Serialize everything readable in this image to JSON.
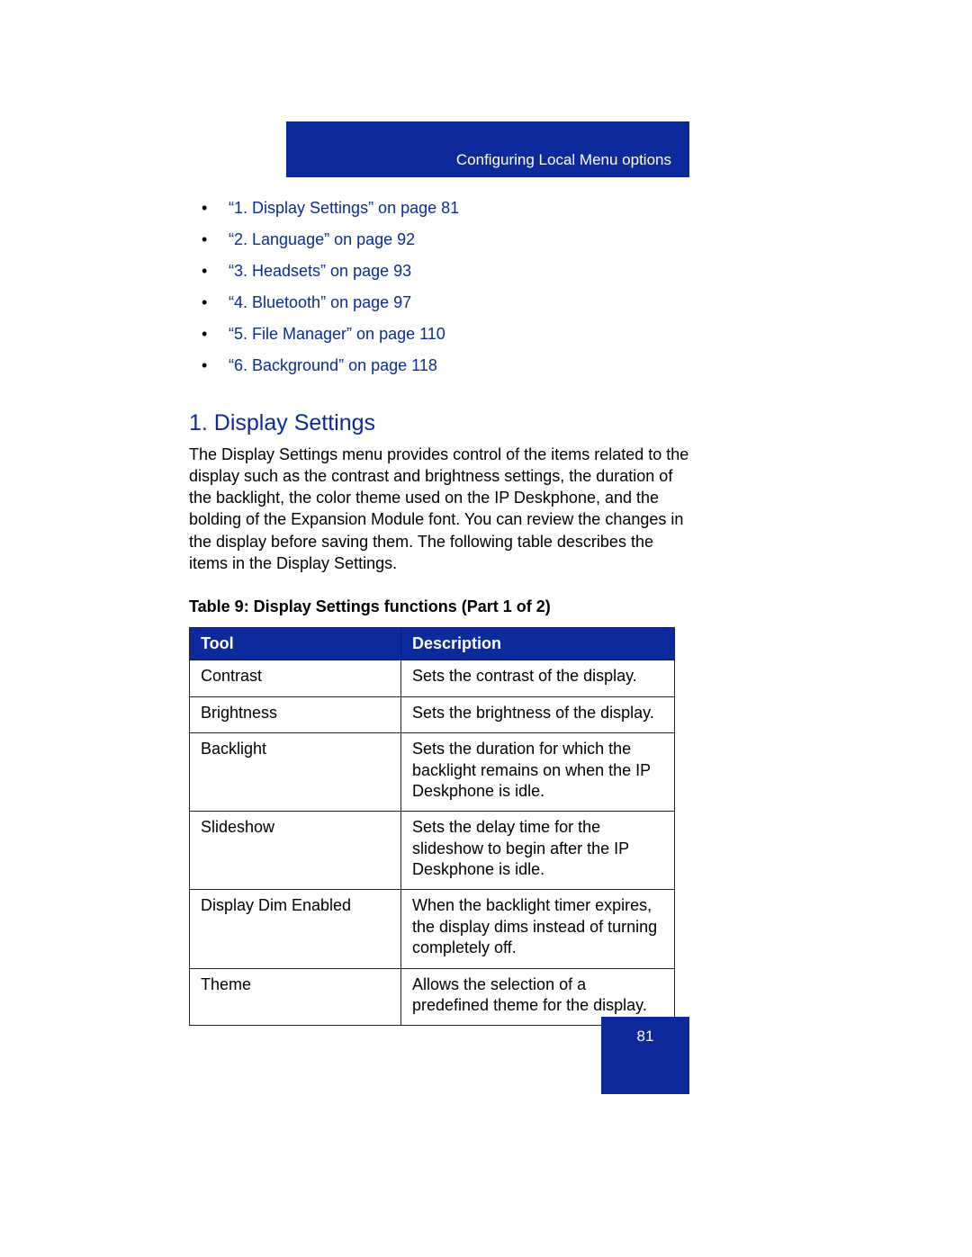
{
  "header": {
    "breadcrumb": "Configuring Local Menu options"
  },
  "navList": [
    "“1. Display Settings” on page 81",
    "“2. Language” on page 92",
    "“3. Headsets” on page 93",
    "“4. Bluetooth” on page 97",
    "“5. File Manager” on page 110",
    "“6. Background” on page 118"
  ],
  "section": {
    "heading": "1. Display Settings",
    "body": "The Display Settings menu provides control of the items related to the display such as the contrast and brightness settings, the duration of the backlight, the color theme used on the IP Deskphone, and the bolding of the Expansion Module font. You can review the changes in the display before saving them. The following table describes the items in the Display Settings."
  },
  "table": {
    "title": "Table 9: Display Settings functions (Part 1 of 2)",
    "headers": {
      "tool": "Tool",
      "description": "Description"
    },
    "rows": [
      {
        "tool": "Contrast",
        "description": "Sets the contrast of the display."
      },
      {
        "tool": "Brightness",
        "description": "Sets the brightness of the display."
      },
      {
        "tool": "Backlight",
        "description": "Sets the duration for which the backlight remains on when the IP Deskphone is idle."
      },
      {
        "tool": "Slideshow",
        "description": "Sets the delay time for the slideshow to begin after the IP Deskphone is idle."
      },
      {
        "tool": "Display Dim Enabled",
        "description": "When the backlight timer expires, the display dims instead of turning completely off."
      },
      {
        "tool": "Theme",
        "description": "Allows the selection of a predefined theme for the display."
      }
    ]
  },
  "pageNumber": "81"
}
